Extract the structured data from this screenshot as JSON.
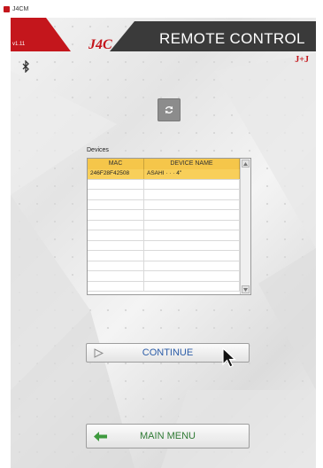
{
  "titlebar": {
    "title": "J4CM"
  },
  "header": {
    "version": "v1.11",
    "logo_text": "J4C",
    "title": "REMOTE CONTROL",
    "brand": "J+J"
  },
  "icons": {
    "bluetooth": "bluetooth-icon",
    "refresh": "refresh-icon",
    "continue": "play-outline-icon",
    "main_menu": "green-back-arrow-icon"
  },
  "devices": {
    "label": "Devices",
    "columns": [
      "MAC",
      "DEVICE NAME"
    ],
    "rows": [
      {
        "mac": "246F28F42508",
        "name": "ASAHI · · · 4\"",
        "selected": true
      }
    ]
  },
  "buttons": {
    "continue": "CONTINUE",
    "main_menu": "MAIN MENU"
  },
  "colors": {
    "brand_red": "#c4161c",
    "header_dark": "#3a3a3a",
    "selection_yellow": "#f8cf5a",
    "link_blue": "#2c5da8",
    "menu_green": "#2f7a34"
  }
}
